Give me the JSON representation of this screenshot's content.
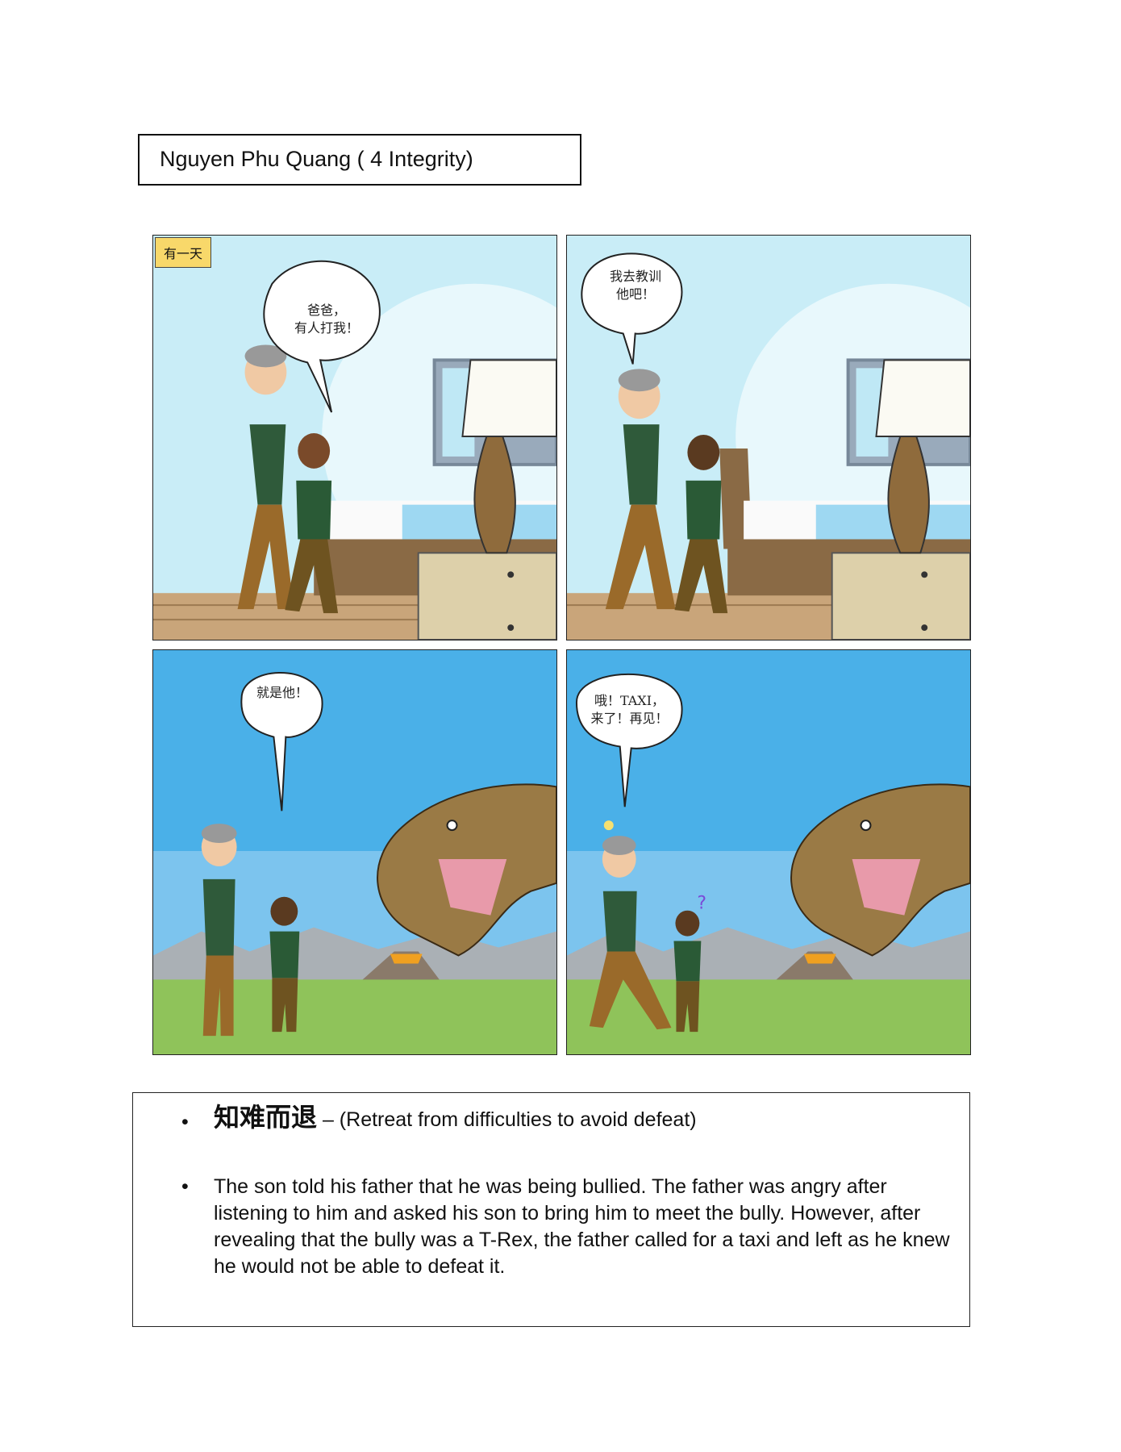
{
  "header": {
    "name": "Nguyen Phu Quang ( 4 Integrity)"
  },
  "comic": {
    "panel1": {
      "caption": "有一天",
      "bubble": "爸爸，\n有人打我！"
    },
    "panel2": {
      "bubble": "我去教训\n他吧！"
    },
    "panel3": {
      "bubble": "就是他！"
    },
    "panel4": {
      "bubble": "哦！TAXI，\n来了！再见！"
    }
  },
  "summary": {
    "idiom": "知难而退",
    "idiom_meaning": " – (Retreat from difficulties to avoid defeat)",
    "story": "The son told his father that he was being bullied. The father was angry after listening to him and asked his son to bring him to meet the bully. However, after revealing that the bully was a T-Rex, the father called for a taxi and left as he knew he would not be able to defeat it."
  },
  "colors": {
    "sky_indoor": "#c9edf7",
    "sky_outdoor": "#4ab0e8",
    "grass": "#8fc35a",
    "caption_bg": "#f8d86a"
  }
}
